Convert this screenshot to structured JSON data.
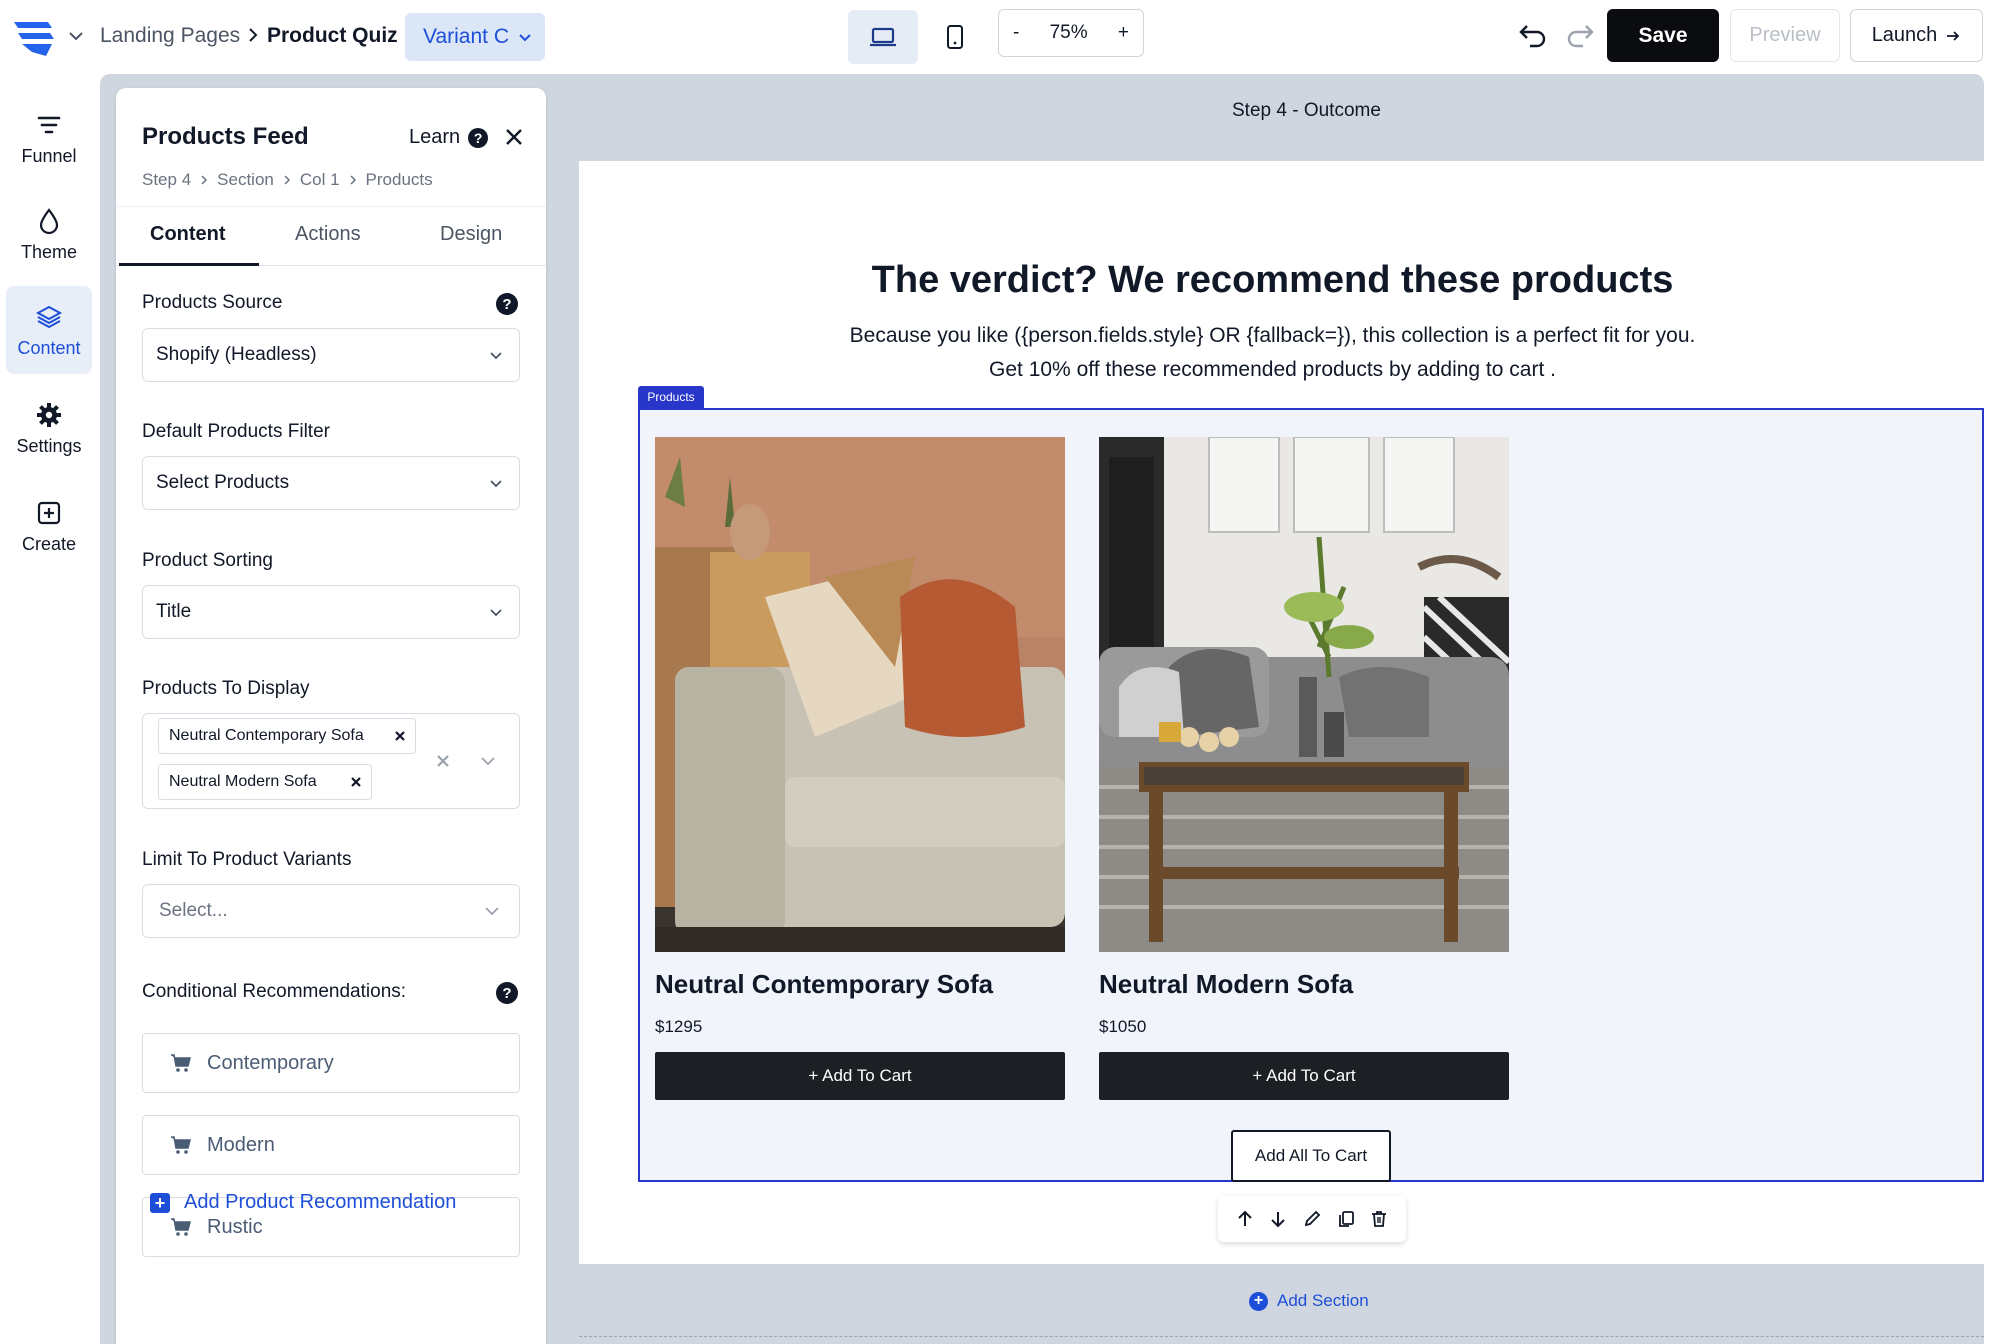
{
  "topbar": {
    "breadcrumb_parent": "Landing Pages",
    "breadcrumb_current": "Product Quiz",
    "variant_label": "Variant C",
    "zoom_minus": "-",
    "zoom_value": "75%",
    "zoom_plus": "+",
    "save_label": "Save",
    "preview_label": "Preview",
    "launch_label": "Launch"
  },
  "leftnav": {
    "items": [
      {
        "label": "Funnel",
        "icon": "filter-lines-icon"
      },
      {
        "label": "Theme",
        "icon": "drop-icon"
      },
      {
        "label": "Content",
        "icon": "layers-icon"
      },
      {
        "label": "Settings",
        "icon": "gear-icon"
      },
      {
        "label": "Create",
        "icon": "plus-square-icon"
      }
    ],
    "active": "Content"
  },
  "panel": {
    "title": "Products Feed",
    "learn_label": "Learn",
    "breadcrumbs": [
      "Step 4",
      "Section",
      "Col 1",
      "Products"
    ],
    "tabs": [
      "Content",
      "Actions",
      "Design"
    ],
    "active_tab": "Content",
    "products_source_label": "Products Source",
    "products_source_value": "Shopify (Headless)",
    "default_filter_label": "Default Products Filter",
    "default_filter_value": "Select Products",
    "sorting_label": "Product Sorting",
    "sorting_value": "Title",
    "display_label": "Products To Display",
    "display_chips": [
      "Neutral Contemporary Sofa",
      "Neutral Modern Sofa"
    ],
    "variants_label": "Limit To Product Variants",
    "variants_placeholder": "Select...",
    "conditional_label": "Conditional Recommendations:",
    "recommendations": [
      "Contemporary",
      "Modern",
      "Rustic"
    ],
    "add_recommendation_label": "Add Product Recommendation"
  },
  "canvas": {
    "step_label": "Step 4 - Outcome",
    "headline": "The verdict? We recommend these products",
    "subline_1": "Because you like ({person.fields.style} OR {fallback=}), this collection is a perfect fit for you.",
    "subline_2": "Get 10% off these recommended products by adding to cart .",
    "section_tag": "Products",
    "products": [
      {
        "name": "Neutral Contemporary Sofa",
        "price": "$1295",
        "button": "+ Add To Cart"
      },
      {
        "name": "Neutral Modern Sofa",
        "price": "$1050",
        "button": "+ Add To Cart"
      }
    ],
    "add_all_label": "Add All To Cart",
    "add_section_label": "Add Section"
  },
  "colors": {
    "accent": "#1d4ed8",
    "section_outline": "#2837c9",
    "canvas_bg": "#cfd6df",
    "button_dark": "#1c1f24"
  }
}
